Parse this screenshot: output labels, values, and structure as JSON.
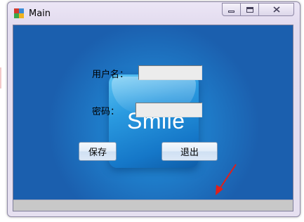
{
  "window": {
    "title": "Main"
  },
  "login": {
    "username_label": "用户名：",
    "username_value": "",
    "password_label": "密码：",
    "password_value": "",
    "save_button": "保存",
    "exit_button": "退出"
  },
  "background": {
    "logo_text": "Smile"
  },
  "colors": {
    "accent_blue": "#1f7fcc",
    "arrow": "#e0201a"
  },
  "icons": {
    "app": "app-grid-icon",
    "minimize": "minimize-icon",
    "maximize": "maximize-icon",
    "close": "close-icon"
  }
}
